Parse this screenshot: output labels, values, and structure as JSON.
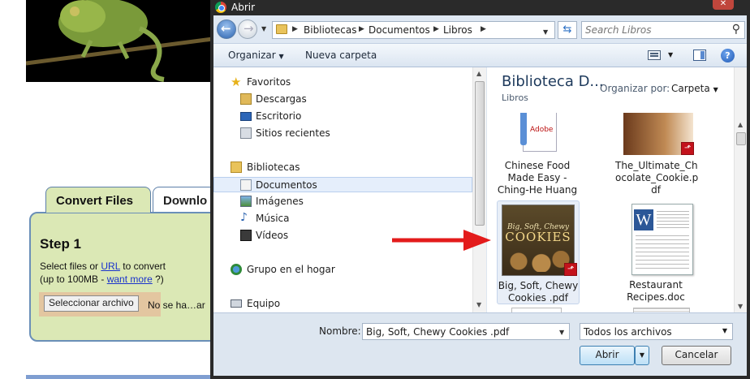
{
  "background_page": {
    "tabs": [
      {
        "label": "Convert Files"
      },
      {
        "label": "Downlo"
      }
    ],
    "step_title": "Step 1",
    "step_line1_a": "Select files or ",
    "step_line1_link": "URL",
    "step_line1_b": " to convert",
    "step_line2_a": "(up to 100MB - ",
    "step_line2_link": "want more",
    "step_line2_b": " ?)",
    "file_button": "Seleccionar archivo",
    "file_status": "No se ha…ar"
  },
  "dialog": {
    "title": "Abrir",
    "breadcrumbs": [
      "Bibliotecas",
      "Documentos",
      "Libros"
    ],
    "search_placeholder": "Search Libros",
    "toolbar": {
      "organize": "Organizar",
      "new_folder": "Nueva carpeta"
    },
    "nav_items": [
      {
        "label": "Favoritos",
        "icon": "star-icon"
      },
      {
        "label": "Descargas",
        "icon": "downloads-folder-icon"
      },
      {
        "label": "Escritorio",
        "icon": "desktop-icon"
      },
      {
        "label": "Sitios recientes",
        "icon": "recent-places-icon"
      },
      {
        "label": "Bibliotecas",
        "icon": "libraries-icon"
      },
      {
        "label": "Documentos",
        "icon": "documents-icon"
      },
      {
        "label": "Imágenes",
        "icon": "pictures-icon"
      },
      {
        "label": "Música",
        "icon": "music-icon"
      },
      {
        "label": "Vídeos",
        "icon": "videos-icon"
      },
      {
        "label": "Grupo en el hogar",
        "icon": "homegroup-icon"
      },
      {
        "label": "Equipo",
        "icon": "computer-icon"
      }
    ],
    "library_title": "Biblioteca D...",
    "library_subtitle": "Libros",
    "arrange_label": "Organizar por:",
    "arrange_value": "Carpeta",
    "files": [
      {
        "name_lines": [
          "Chinese Food",
          "Made Easy -",
          "Ching-He Huang"
        ]
      },
      {
        "name_lines": [
          "The_Ultimate_Ch",
          "ocolate_Cookie.p",
          "df"
        ]
      },
      {
        "name_lines": [
          "Big, Soft, Chewy",
          "Cookies .pdf"
        ],
        "cover_top": "Big, Soft, Chewy",
        "cover_main": "COOKIES"
      },
      {
        "name_lines": [
          "Restaurant",
          "Recipes.doc"
        ]
      }
    ],
    "filename_label": "Nombre:",
    "filename_value": "Big, Soft, Chewy Cookies .pdf",
    "filetype_value": "Todos los archivos",
    "open_button": "Abrir",
    "cancel_button": "Cancelar",
    "adobe_label": "Adobe"
  },
  "colors": {
    "accent_red": "#e31b1b",
    "panel_green": "#dbe8b5",
    "selection_blue": "#e5eefb"
  }
}
